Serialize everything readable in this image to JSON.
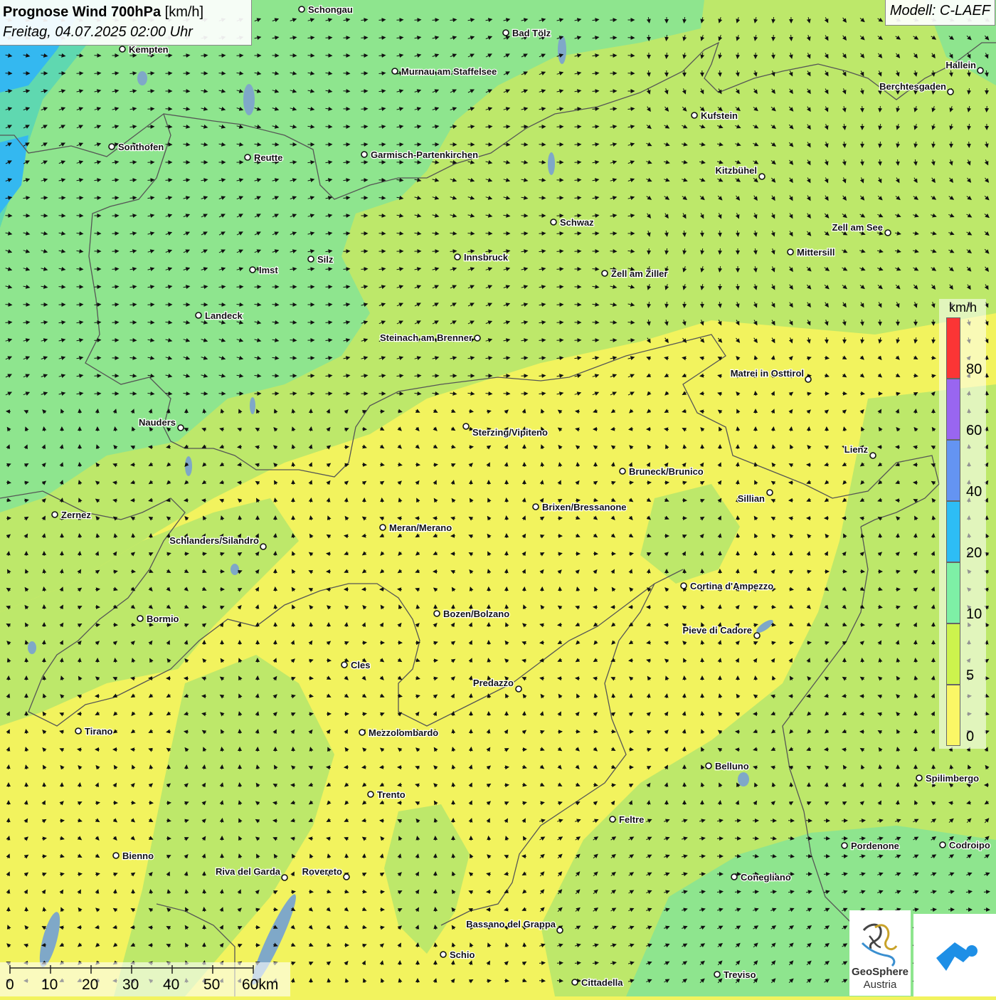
{
  "header": {
    "title_bold": "Prognose Wind 700hPa",
    "title_unit": "[km/h]",
    "datetime": "Freitag, 04.07.2025 02:00 Uhr",
    "model": "Modell: C-LAEF"
  },
  "legend": {
    "unit": "km/h",
    "labels": [
      "80",
      "60",
      "40",
      "20",
      "10",
      "5",
      "0"
    ],
    "colors": [
      "#fb3535",
      "#9966f0",
      "#6494f2",
      "#2dbdf5",
      "#7ef0a6",
      "#cdf34d",
      "#fbf766"
    ]
  },
  "scale_bar": {
    "labels": [
      "0",
      "10",
      "20",
      "30",
      "40",
      "50",
      "60km"
    ]
  },
  "logos": {
    "geosphere_line1": "GeoSphere",
    "geosphere_line2": "Austria",
    "geosphere_icon": "geosphere-logo-icon",
    "app_icon": "warning-app-logo-icon"
  },
  "map_colors": {
    "very_light_wind": "#f2f35e",
    "light_wind": "#bde86a",
    "moderate_wind": "#8ee58e",
    "fresh_wind": "#5fd8b0",
    "strong_wind": "#34b8f0",
    "lakes": "#7fa8c8",
    "borders": "#555555"
  },
  "cities": [
    {
      "name": "Schongau"
    },
    {
      "name": "Bad Tölz"
    },
    {
      "name": "Kempten"
    },
    {
      "name": "Murnau am Staffelsee"
    },
    {
      "name": "Hallein"
    },
    {
      "name": "Berchtesgaden"
    },
    {
      "name": "Kufstein"
    },
    {
      "name": "Sonthofen"
    },
    {
      "name": "Reutte"
    },
    {
      "name": "Garmisch-Partenkirchen"
    },
    {
      "name": "Kitzbühel"
    },
    {
      "name": "Schwaz"
    },
    {
      "name": "Zell am See"
    },
    {
      "name": "Innsbruck"
    },
    {
      "name": "Mittersill"
    },
    {
      "name": "Silz"
    },
    {
      "name": "Imst"
    },
    {
      "name": "Zell am Ziller"
    },
    {
      "name": "Landeck"
    },
    {
      "name": "Steinach am Brenner"
    },
    {
      "name": "Matrei in Osttirol"
    },
    {
      "name": "Nauders"
    },
    {
      "name": "Sterzing/Vipiteno"
    },
    {
      "name": "Lienz"
    },
    {
      "name": "Bruneck/Brunico"
    },
    {
      "name": "Sillian"
    },
    {
      "name": "Brixen/Bressanone"
    },
    {
      "name": "Zernez"
    },
    {
      "name": "Meran/Merano"
    },
    {
      "name": "Schlanders/Silandro"
    },
    {
      "name": "Cortina d'Ampezzo"
    },
    {
      "name": "Bozen/Bolzano"
    },
    {
      "name": "Bormio"
    },
    {
      "name": "Pieve di Cadore"
    },
    {
      "name": "Cles"
    },
    {
      "name": "Predazzo"
    },
    {
      "name": "Tirano"
    },
    {
      "name": "Mezzolombardo"
    },
    {
      "name": "Belluno"
    },
    {
      "name": "Spilimbergo"
    },
    {
      "name": "Trento"
    },
    {
      "name": "Feltre"
    },
    {
      "name": "Pordenone"
    },
    {
      "name": "Codroipo"
    },
    {
      "name": "Bienno"
    },
    {
      "name": "Riva del Garda"
    },
    {
      "name": "Rovereto"
    },
    {
      "name": "Conegliano"
    },
    {
      "name": "Bassano del Grappa"
    },
    {
      "name": "Schio"
    },
    {
      "name": "Treviso"
    },
    {
      "name": "Cittadella"
    }
  ]
}
